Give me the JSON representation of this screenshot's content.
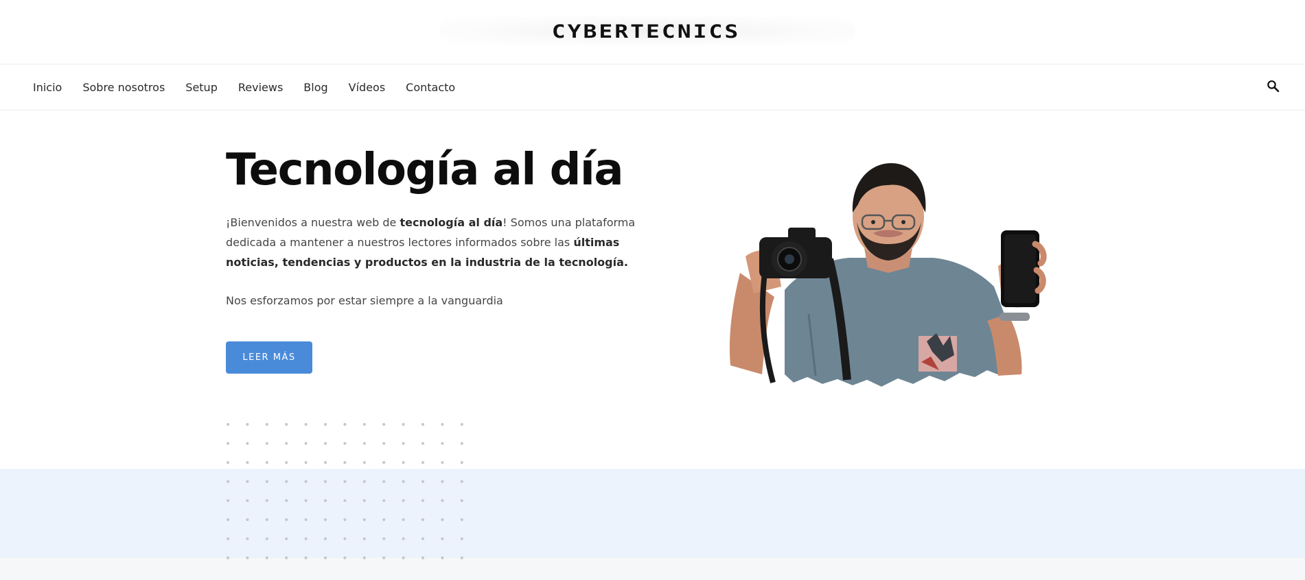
{
  "header": {
    "logo_text": "CYBERTECNICS"
  },
  "nav": {
    "items": [
      "Inicio",
      "Sobre nosotros",
      "Setup",
      "Reviews",
      "Blog",
      "Vídeos",
      "Contacto"
    ],
    "search_icon": "search-icon"
  },
  "hero": {
    "title": "Tecnología al día",
    "intro": {
      "part1": "¡Bienvenidos a nuestra web de ",
      "bold1": "tecnología al día",
      "part2": "! Somos una plataforma dedicada a mantener a nuestros lectores informados sobre las ",
      "bold2": "últimas noticias, tendencias y productos en la industria de la tecnología."
    },
    "subtext": "Nos esforzamos por estar siempre a la vanguardia",
    "cta_label": "LEER MÁS",
    "image_icon": "person-with-camera-and-phone-image"
  },
  "colors": {
    "accent": "#4a8bd9",
    "band_blue": "#edf3fc",
    "band_gray": "#f6f7f9",
    "text_dark": "#0d0d0d"
  }
}
